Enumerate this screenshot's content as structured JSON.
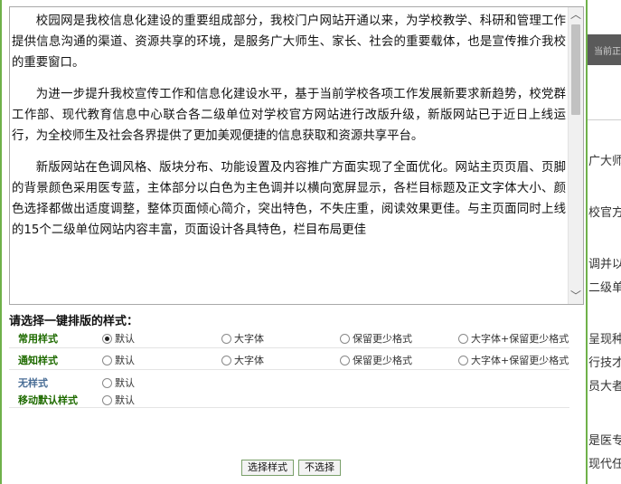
{
  "background": {
    "topbar_text": "当前正",
    "fragments": [
      "广大师",
      "校官方",
      "调并以",
      "二级单",
      "呈现种",
      "行技才",
      "员大者",
      "是医专",
      "现代任"
    ]
  },
  "preview": {
    "paragraphs": [
      "校园网是我校信息化建设的重要组成部分，我校门户网站开通以来，为学校教学、科研和管理工作提供信息沟通的渠道、资源共享的环境，是服务广大师生、家长、社会的重要载体，也是宣传推介我校的重要窗口。",
      "为进一步提升我校宣传工作和信息化建设水平，基于当前学校各项工作发展新要求新趋势，校党群工作部、现代教育信息中心联合各二级单位对学校官方网站进行改版升级，新版网站已于近日上线运行，为全校师生及社会各界提供了更加美观便捷的信息获取和资源共享平台。",
      "新版网站在色调风格、版块分布、功能设置及内容推广方面实现了全面优化。网站主页页眉、页脚的背景颜色采用医专蓝，主体部分以白色为主色调并以横向宽屏显示，各栏目标题及正文字体大小、颜色选择都做出适度调整，整体页面倾心简介，突出特色，不失庄重，阅读效果更佳。与主页面同时上线的15个二级单位网站内容丰富，页面设计各具特色，栏目布局更佳"
    ],
    "scroll_up_icon": "︿",
    "scroll_down_icon": "﹀"
  },
  "prompt": "请选择一键排版的样式：",
  "rows": [
    {
      "label": "常用样式",
      "options": [
        "默认",
        "大字体",
        "保留更少格式",
        "大字体+保留更少格式"
      ],
      "selected": 0
    },
    {
      "label": "通知样式",
      "options": [
        "默认",
        "大字体",
        "保留更少格式",
        "大字体+保留更少格式"
      ],
      "selected": -1
    },
    {
      "label": "无样式",
      "options": [
        "默认"
      ],
      "selected": -1
    },
    {
      "label": "移动默认样式",
      "options": [
        "默认"
      ],
      "selected": -1
    }
  ],
  "buttons": {
    "select": "选择样式",
    "cancel": "不选择"
  },
  "colors": {
    "border": "#6fb14a",
    "label_green": "#1f6b00",
    "label_blue": "#4a6e96"
  }
}
